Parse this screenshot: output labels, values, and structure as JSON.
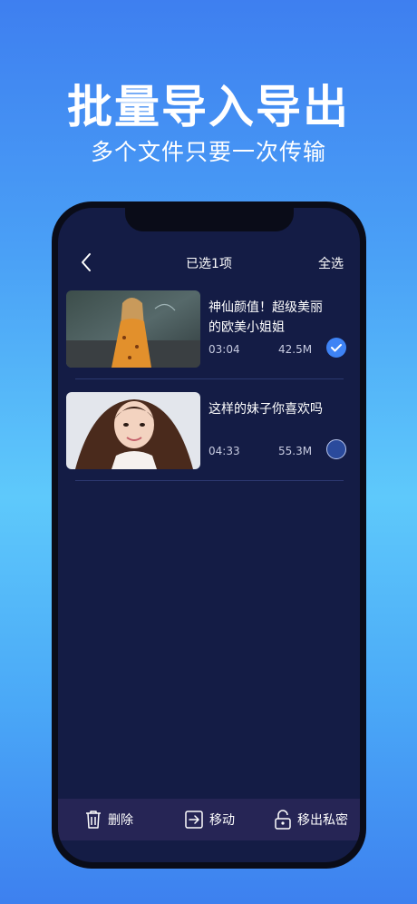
{
  "promo": {
    "headline": "批量导入导出",
    "subline": "多个文件只要一次传输"
  },
  "nav": {
    "back_icon": "chevron-left-icon",
    "title": "已选1项",
    "select_all": "全选"
  },
  "items": [
    {
      "title": "神仙颜值！超级美丽的欧美小姐姐",
      "duration": "03:04",
      "size": "42.5M",
      "selected": true
    },
    {
      "title": "这样的妹子你喜欢吗",
      "duration": "04:33",
      "size": "55.3M",
      "selected": false
    }
  ],
  "toolbar": {
    "delete_label": "删除",
    "move_label": "移动",
    "unlock_label": "移出私密"
  },
  "colors": {
    "screen_bg": "#141c45",
    "accent": "#3e83f5",
    "toolbar_bg": "#262555"
  }
}
